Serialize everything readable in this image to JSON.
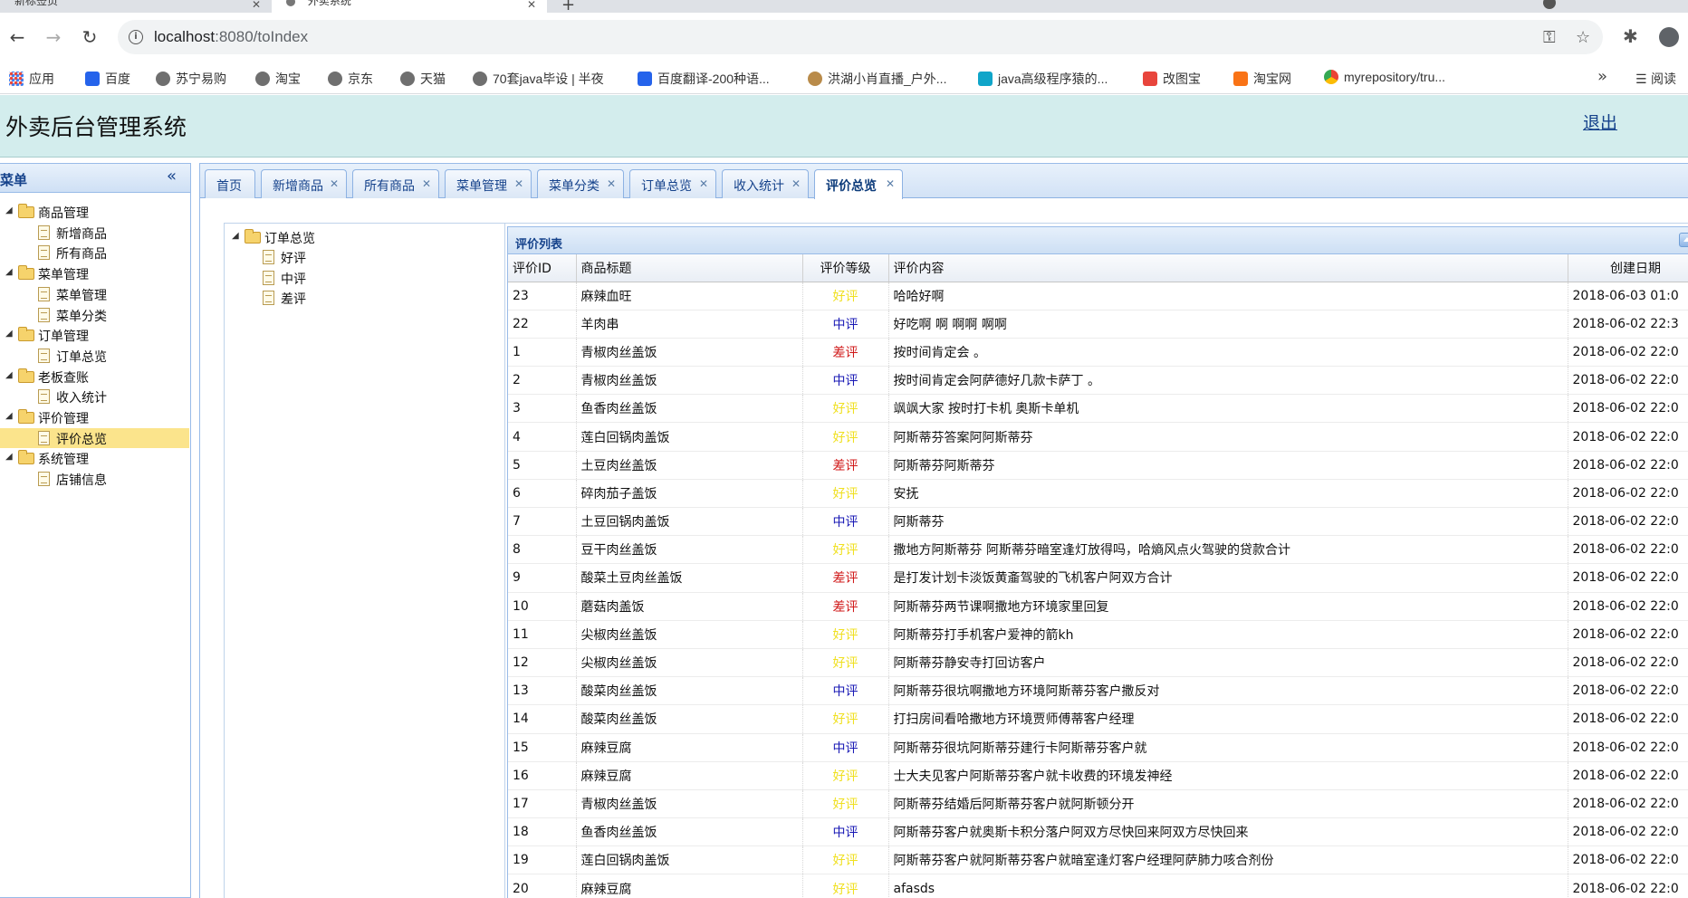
{
  "browser": {
    "tabs": [
      {
        "label": "新标签页"
      },
      {
        "label": "外卖系统"
      }
    ],
    "url_host": "localhost",
    "url_path": ":8080/toIndex",
    "bookmarks": [
      {
        "label": "应用",
        "icon": "apps-grid-icon"
      },
      {
        "label": "百度",
        "icon": "baidu-icon"
      },
      {
        "label": "苏宁易购",
        "icon": "globe-icon"
      },
      {
        "label": "淘宝",
        "icon": "globe-icon"
      },
      {
        "label": "京东",
        "icon": "globe-icon"
      },
      {
        "label": "天猫",
        "icon": "globe-icon"
      },
      {
        "label": "70套java毕设 | 半夜",
        "icon": "globe-icon"
      },
      {
        "label": "百度翻译-200种语...",
        "icon": "translate-icon"
      },
      {
        "label": "洪湖小肖直播_户外...",
        "icon": "live-icon"
      },
      {
        "label": "java高级程序猿的...",
        "icon": "bilibili-icon"
      },
      {
        "label": "改图宝",
        "icon": "image-icon"
      },
      {
        "label": "淘宝网",
        "icon": "taobao-icon"
      },
      {
        "label": "myrepository/tru...",
        "icon": "chrome-icon"
      }
    ],
    "reading_list": "阅读"
  },
  "app": {
    "title": "外卖后台管理系统",
    "logout": "退出"
  },
  "sidebar": {
    "title": "菜单",
    "collapse_glyph": "«",
    "groups": [
      {
        "label": "商品管理",
        "items": [
          "新增商品",
          "所有商品"
        ]
      },
      {
        "label": "菜单管理",
        "items": [
          "菜单管理",
          "菜单分类"
        ]
      },
      {
        "label": "订单管理",
        "items": [
          "订单总览"
        ]
      },
      {
        "label": "老板查账",
        "items": [
          "收入统计"
        ]
      },
      {
        "label": "评价管理",
        "items": [
          "评价总览"
        ]
      },
      {
        "label": "系统管理",
        "items": [
          "店铺信息"
        ]
      }
    ],
    "selected": "评价总览"
  },
  "tabs": [
    {
      "label": "首页",
      "closable": false
    },
    {
      "label": "新增商品",
      "closable": true
    },
    {
      "label": "所有商品",
      "closable": true
    },
    {
      "label": "菜单管理",
      "closable": true
    },
    {
      "label": "菜单分类",
      "closable": true
    },
    {
      "label": "订单总览",
      "closable": true
    },
    {
      "label": "收入统计",
      "closable": true
    },
    {
      "label": "评价总览",
      "closable": true,
      "active": true
    }
  ],
  "filter_tree": {
    "root": "订单总览",
    "items": [
      "好评",
      "中评",
      "差评"
    ]
  },
  "grid": {
    "title": "评价列表",
    "columns": [
      "评价ID",
      "商品标题",
      "评价等级",
      "评价内容",
      "创建日期"
    ],
    "level_colors": {
      "好评": "#f0e020",
      "中评": "#1a1ab5",
      "差评": "#d01a1a"
    },
    "rows": [
      {
        "id": "23",
        "title": "麻辣血旺",
        "level": "好评",
        "content": "哈哈好啊",
        "date": "2018-06-03 01:0"
      },
      {
        "id": "22",
        "title": "羊肉串",
        "level": "中评",
        "content": "好吃啊 啊 啊啊 啊啊",
        "date": "2018-06-02 22:3"
      },
      {
        "id": "1",
        "title": "青椒肉丝盖饭",
        "level": "差评",
        "content": "按时间肯定会 。",
        "date": "2018-06-02 22:0"
      },
      {
        "id": "2",
        "title": "青椒肉丝盖饭",
        "level": "中评",
        "content": "按时间肯定会阿萨德好几款卡萨丁 。",
        "date": "2018-06-02 22:0"
      },
      {
        "id": "3",
        "title": "鱼香肉丝盖饭",
        "level": "好评",
        "content": "飒飒大家 按时打卡机 奥斯卡单机",
        "date": "2018-06-02 22:0"
      },
      {
        "id": "4",
        "title": "莲白回锅肉盖饭",
        "level": "好评",
        "content": "阿斯蒂芬答案阿阿斯蒂芬",
        "date": "2018-06-02 22:0"
      },
      {
        "id": "5",
        "title": "土豆肉丝盖饭",
        "level": "差评",
        "content": "阿斯蒂芬阿斯蒂芬",
        "date": "2018-06-02 22:0"
      },
      {
        "id": "6",
        "title": "碎肉茄子盖饭",
        "level": "好评",
        "content": "安抚",
        "date": "2018-06-02 22:0"
      },
      {
        "id": "7",
        "title": "土豆回锅肉盖饭",
        "level": "中评",
        "content": "阿斯蒂芬",
        "date": "2018-06-02 22:0"
      },
      {
        "id": "8",
        "title": "豆干肉丝盖饭",
        "level": "好评",
        "content": "撒地方阿斯蒂芬 阿斯蒂芬暗室逢灯放得吗，哈熵风点火驾驶的贷款合计",
        "date": "2018-06-02 22:0"
      },
      {
        "id": "9",
        "title": "酸菜土豆肉丝盖饭",
        "level": "差评",
        "content": "是打发计划卡淡饭黄齑驾驶的飞机客户阿双方合计",
        "date": "2018-06-02 22:0"
      },
      {
        "id": "10",
        "title": "蘑菇肉盖饭",
        "level": "差评",
        "content": "阿斯蒂芬两节课啊撒地方环境家里回复",
        "date": "2018-06-02 22:0"
      },
      {
        "id": "11",
        "title": "尖椒肉丝盖饭",
        "level": "好评",
        "content": "阿斯蒂芬打手机客户爱神的箭kh",
        "date": "2018-06-02 22:0"
      },
      {
        "id": "12",
        "title": "尖椒肉丝盖饭",
        "level": "好评",
        "content": "阿斯蒂芬静安寺打回访客户",
        "date": "2018-06-02 22:0"
      },
      {
        "id": "13",
        "title": "酸菜肉丝盖饭",
        "level": "中评",
        "content": "阿斯蒂芬很坑啊撒地方环境阿斯蒂芬客户撒反对",
        "date": "2018-06-02 22:0"
      },
      {
        "id": "14",
        "title": "酸菜肉丝盖饭",
        "level": "好评",
        "content": "打扫房间看哈撒地方环境贾师傅蒂客户经理",
        "date": "2018-06-02 22:0"
      },
      {
        "id": "15",
        "title": "麻辣豆腐",
        "level": "中评",
        "content": "阿斯蒂芬很坑阿斯蒂芬建行卡阿斯蒂芬客户就",
        "date": "2018-06-02 22:0"
      },
      {
        "id": "16",
        "title": "麻辣豆腐",
        "level": "好评",
        "content": "士大夫见客户阿斯蒂芬客户就卡收费的环境发神经",
        "date": "2018-06-02 22:0"
      },
      {
        "id": "17",
        "title": "青椒肉丝盖饭",
        "level": "好评",
        "content": "阿斯蒂芬结婚后阿斯蒂芬客户就阿斯顿分开",
        "date": "2018-06-02 22:0"
      },
      {
        "id": "18",
        "title": "鱼香肉丝盖饭",
        "level": "中评",
        "content": "阿斯蒂芬客户就奥斯卡积分落户阿双方尽快回来阿双方尽快回来",
        "date": "2018-06-02 22:0"
      },
      {
        "id": "19",
        "title": "莲白回锅肉盖饭",
        "level": "好评",
        "content": "阿斯蒂芬客户就阿斯蒂芬客户就暗室逢灯客户经理阿萨肺力咳合剂份",
        "date": "2018-06-02 22:0"
      },
      {
        "id": "20",
        "title": "麻辣豆腐",
        "level": "好评",
        "content": "afasds",
        "date": "2018-06-02 22:0"
      }
    ]
  }
}
